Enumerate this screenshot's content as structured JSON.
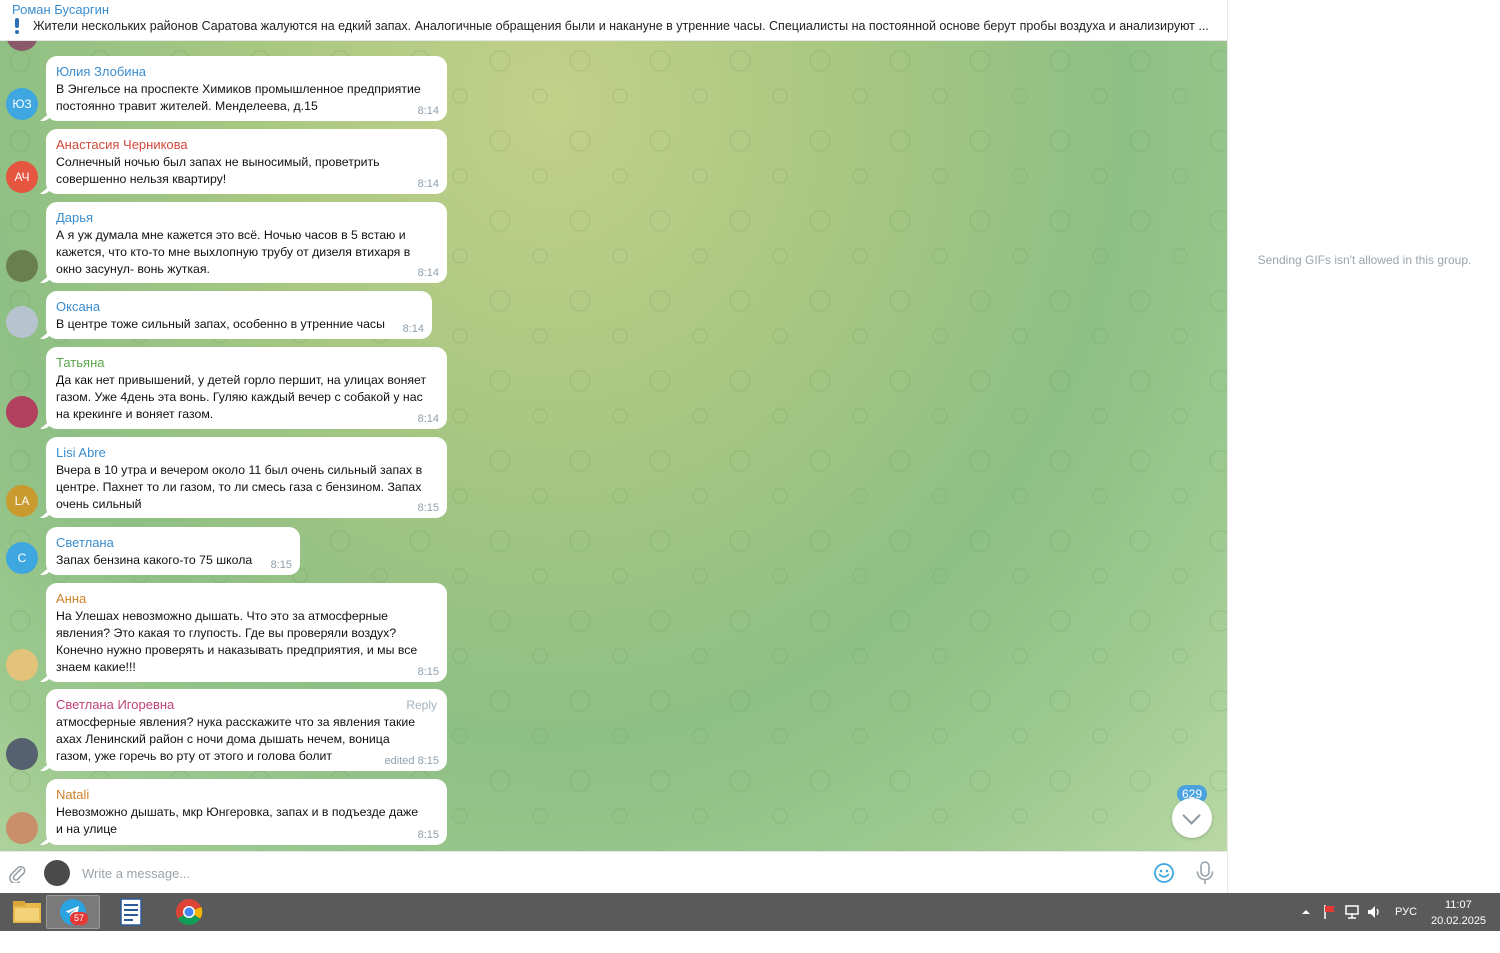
{
  "pinned": {
    "author": "Роман Бусаргин",
    "text": "Жители нескольких районов Саратова жалуются на едкий запах. Аналогичные обращения были и накануне в утренние часы.   Специалисты на постоянной основе берут пробы воздуха и анализируют ..."
  },
  "messages": [
    {
      "name": "Юлия Злобина",
      "name_color": "#3a8dcf",
      "lines": [
        "В Энгельсе на проспекте Химиков промышленное предприятие",
        "постоянно травит жителей. Менделеева, д.15"
      ],
      "time": "8:14",
      "avatar_text": "ЮЗ",
      "avatar_color": "#3fa7e0"
    },
    {
      "name": "Анастасия Черникова",
      "name_color": "#d2493b",
      "lines": [
        "Солнечный ночью был запах не выносимый, проветрить",
        "совершенно нельзя квартиру!"
      ],
      "time": "8:14",
      "avatar_text": "АЧ",
      "avatar_color": "#e5553f"
    },
    {
      "name": "Дарья",
      "name_color": "#3a8dcf",
      "lines": [
        "А я уж думала мне кажется это всё. Ночью часов в 5 встаю и",
        "кажется, что кто-то мне выхлопную трубу от дизеля втихаря в",
        "окно засунул- вонь жуткая."
      ],
      "time": "8:14",
      "avatar_text": "",
      "avatar_color": "#6a7f4f"
    },
    {
      "name": "Оксана",
      "name_color": "#3a8dcf",
      "lines": [
        "В центре тоже сильный запах, особенно в утренние часы"
      ],
      "time": "8:14",
      "avatar_text": "",
      "avatar_color": "#b7c3cf"
    },
    {
      "name": "Татьяна",
      "name_color": "#5aa64a",
      "lines": [
        "Да как нет привышений, у детей горло першит, на улицах воняет",
        "газом. Уже 4день эта вонь. Гуляю каждый вечер с собакой у нас",
        "на крекинге и воняет газом."
      ],
      "time": "8:14",
      "avatar_text": "",
      "avatar_color": "#b0405e"
    },
    {
      "name": "Lisi Abre",
      "name_color": "#3a8dcf",
      "lines": [
        "Вчера в 10 утра и вечером около 11 был очень сильный запах в",
        "центре. Пахнет то ли газом, то ли смесь газа с бензином. Запах",
        "очень сильный"
      ],
      "time": "8:15",
      "avatar_text": "LA",
      "avatar_color": "#c99a2e"
    },
    {
      "name": "Светлана",
      "name_color": "#3a8dcf",
      "lines": [
        "Запах бензина какого-то 75 школа"
      ],
      "time": "8:15",
      "avatar_text": "С",
      "avatar_color": "#3fa7e0"
    },
    {
      "name": "Анна",
      "name_color": "#d0822a",
      "lines": [
        "На Улешах невозможно дышать. Что это за атмосферные",
        "явления? Это какая то глупость. Где вы проверяли воздух?",
        "Конечно нужно проверять и наказывать предприятия, и мы все",
        "знаем какие!!!"
      ],
      "time": "8:15",
      "avatar_text": "",
      "avatar_color": "#e3c27a"
    },
    {
      "name": "Светлана Игоревна",
      "name_color": "#c0447a",
      "lines": [
        "атмосферные явления? нука расскажите что за явления такие",
        "ахах Ленинский район с ночи дома дышать нечем, воница",
        "газом, уже горечь во рту от этого и голова болит"
      ],
      "time": "edited 8:15",
      "reply": "Reply",
      "avatar_text": "",
      "avatar_color": "#556070"
    },
    {
      "name": "Natali",
      "name_color": "#d0822a",
      "lines": [
        "Невозможно дышать, мкр Юнгеровка, запах и в подъезде даже",
        "и на улице"
      ],
      "time": "8:15",
      "avatar_text": "",
      "avatar_color": "#c88f6a"
    }
  ],
  "scroll": {
    "unread": "629"
  },
  "side": {
    "note": "Sending GIFs isn't allowed in this group."
  },
  "composer": {
    "placeholder": "Write a message..."
  },
  "taskbar": {
    "telegram_badge": "57",
    "lang": "РУС",
    "time": "11:07",
    "date": "20.02.2025"
  }
}
